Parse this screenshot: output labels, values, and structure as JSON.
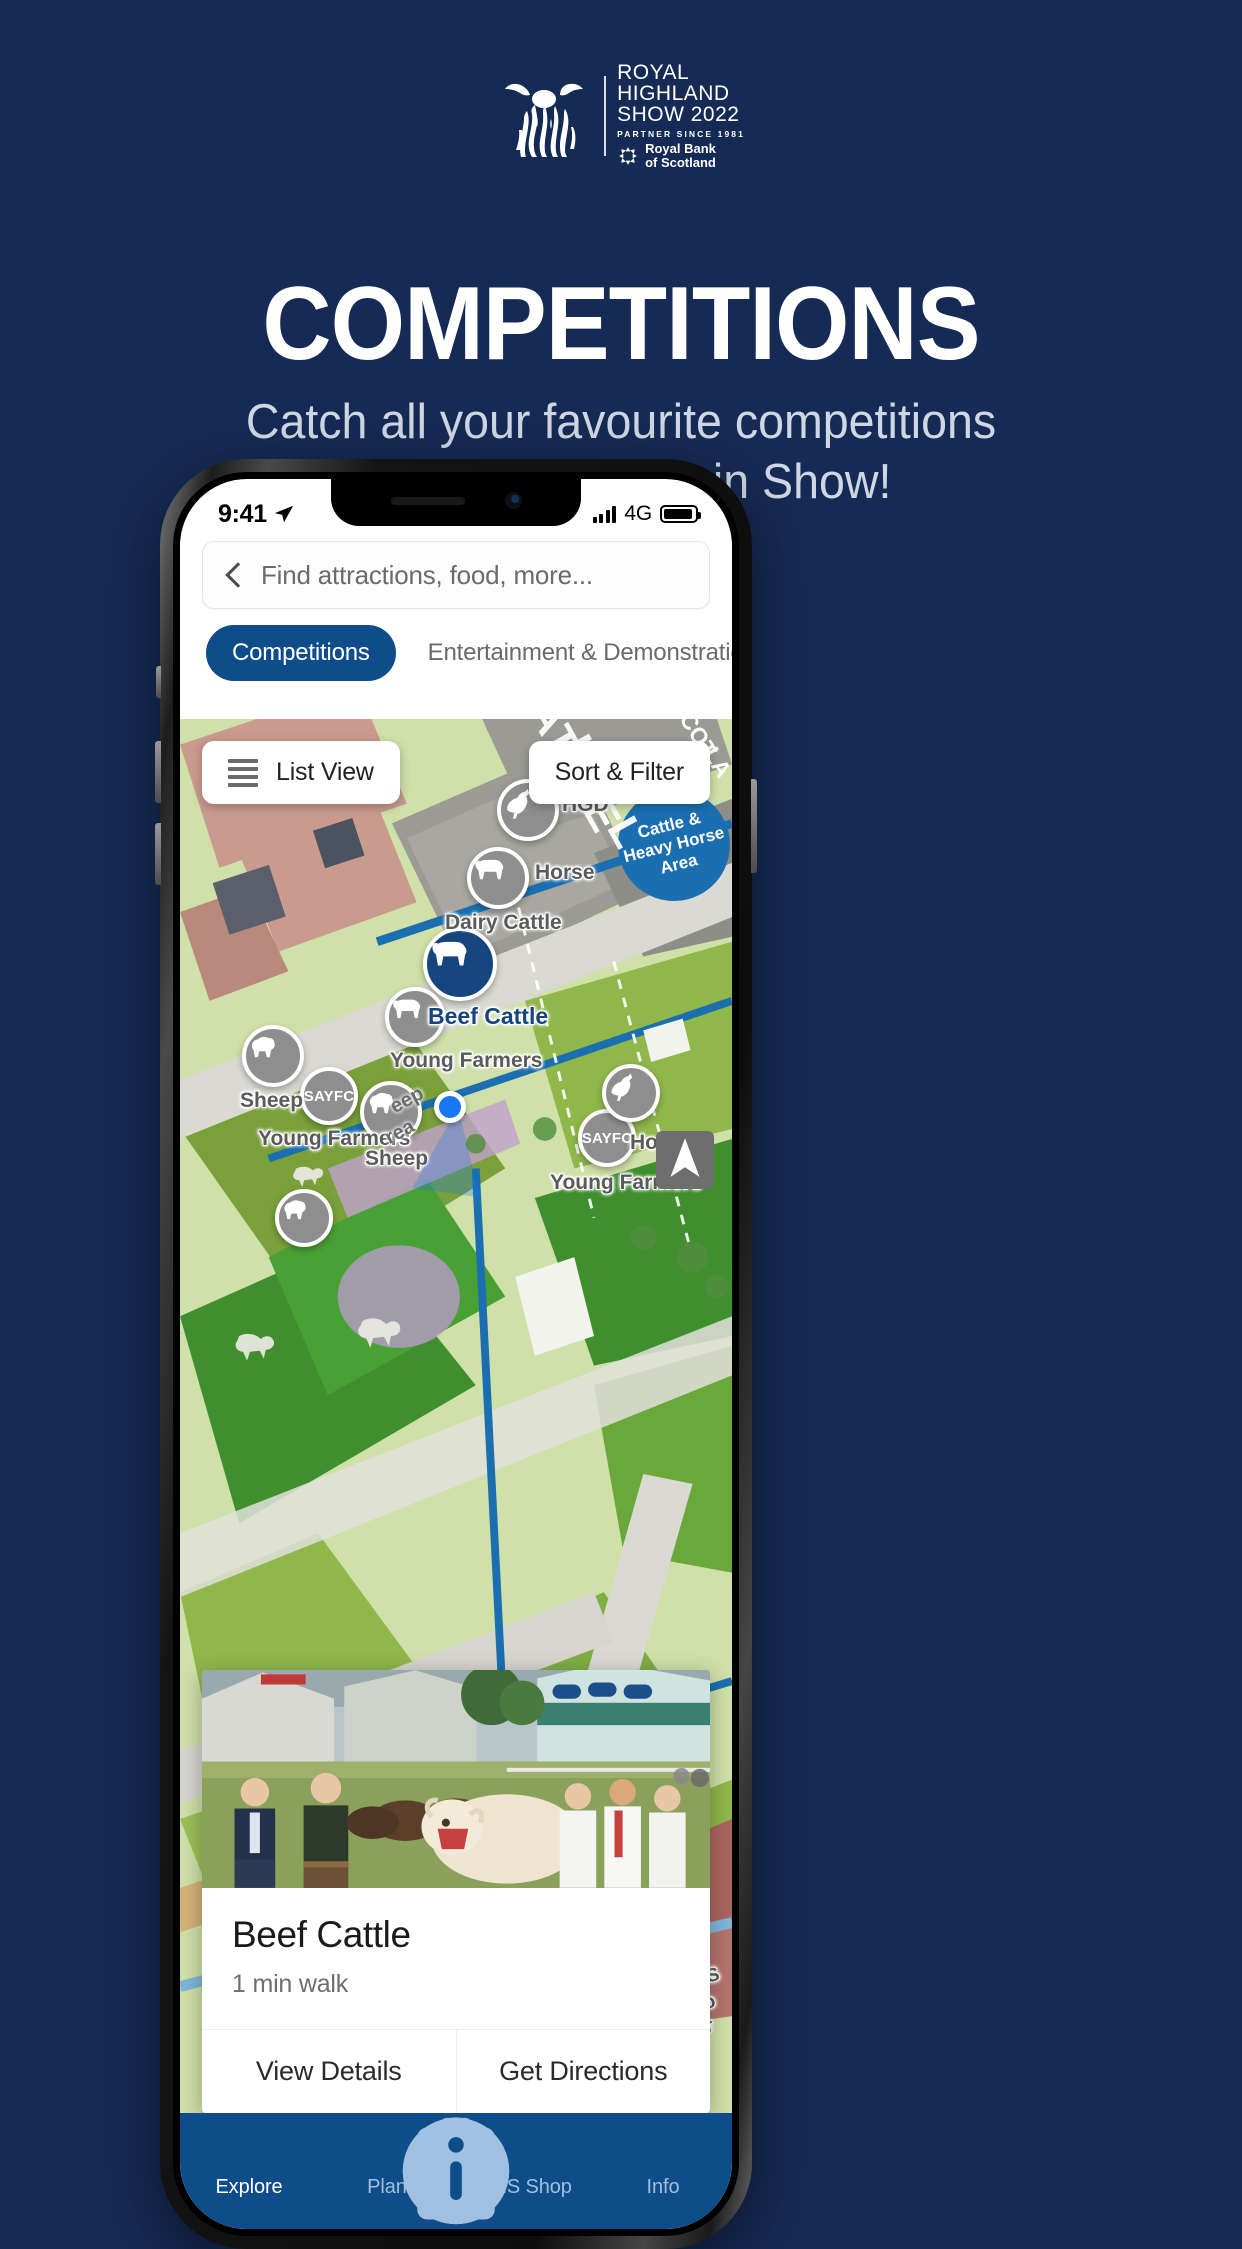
{
  "brand": {
    "logo_lines": [
      "ROYAL",
      "HIGHLAND",
      "SHOW 2022"
    ],
    "partner_line": "PARTNER SINCE 1981",
    "bank_name_line1": "Royal Bank",
    "bank_name_line2": "of Scotland",
    "cow_icon": "highland-cow-icon",
    "bank_icon": "rbs-daisy-icon"
  },
  "hero": {
    "headline": "COMPETITIONS",
    "subhead_line1": "Catch all your favourite competitions",
    "subhead_line2": "and see the Best in Show!"
  },
  "phone": {
    "status": {
      "time": "9:41",
      "location_icon": "location-arrow-icon",
      "signal_icon": "signal-bars-icon",
      "network": "4G",
      "battery_icon": "battery-full-icon"
    },
    "search": {
      "back_icon": "chevron-left-icon",
      "placeholder": "Find attractions, food, more..."
    },
    "tabs": [
      {
        "label": "Competitions",
        "active": true
      },
      {
        "label": "Entertainment & Demonstrations",
        "active": false
      }
    ],
    "map_buttons": {
      "list_view": "List View",
      "list_icon": "list-lines-icon",
      "sort_filter": "Sort & Filter"
    },
    "map_labels": [
      {
        "text": "CATTLE",
        "kind": "white-big"
      },
      {
        "text": "HALL",
        "kind": "white-big"
      },
      {
        "text": "SCOT",
        "kind": "white-small"
      },
      {
        "text": "LA",
        "kind": "white-small"
      },
      {
        "text": "HGD",
        "kind": "grey"
      },
      {
        "text": "Cattle &",
        "kind": "blue-area"
      },
      {
        "text": "Heavy Horse",
        "kind": "blue-area"
      },
      {
        "text": "Area",
        "kind": "blue-area"
      },
      {
        "text": "Horse",
        "kind": "grey"
      },
      {
        "text": "Dairy Cattle",
        "kind": "grey"
      },
      {
        "text": "Beef Cattle",
        "kind": "selected"
      },
      {
        "text": "Young Farmers",
        "kind": "grey"
      },
      {
        "text": "Sheep",
        "kind": "grey"
      },
      {
        "text": "Sheep",
        "kind": "grey"
      },
      {
        "text": "Sheep",
        "kind": "grey"
      },
      {
        "text": "Young Farmers",
        "kind": "grey"
      },
      {
        "text": "Young Farmers",
        "kind": "grey"
      },
      {
        "text": "Horse",
        "kind": "grey"
      },
      {
        "text": "eep",
        "kind": "area-purple"
      },
      {
        "text": "rea",
        "kind": "area-purple"
      },
      {
        "text": "RHS",
        "kind": "grey"
      },
      {
        "text": "Sco",
        "kind": "grey"
      },
      {
        "text": "Cer",
        "kind": "grey"
      }
    ],
    "map_pins": [
      {
        "icon": "horse-icon",
        "label": "HGD",
        "selected": false
      },
      {
        "icon": "cow-icon",
        "label": "Dairy Cattle",
        "selected": false
      },
      {
        "icon": "cow-icon",
        "label": "Beef Cattle",
        "selected": true
      },
      {
        "icon": "cow-icon",
        "label": "Beef Cattle secondary",
        "selected": false
      },
      {
        "icon": "cow-icon",
        "label": "Sheep area",
        "selected": false
      },
      {
        "icon": "sayfc-badge",
        "label": "SAYFC",
        "selected": false
      },
      {
        "icon": "sheep-icon",
        "label": "Sheep",
        "selected": false
      },
      {
        "icon": "sayfc-badge",
        "label": "SAYFC",
        "selected": false
      },
      {
        "icon": "horse-icon",
        "label": "Horse",
        "selected": false
      }
    ],
    "card": {
      "photo_alt": "cattle-parade-photo",
      "title": "Beef Cattle",
      "subtitle": "1 min walk",
      "primary_action": "View Details",
      "secondary_action": "Get Directions"
    },
    "bottom_nav": [
      {
        "label": "Explore",
        "icon": "compass-icon",
        "active": true
      },
      {
        "label": "Plan",
        "icon": "clipboard-list-icon",
        "active": false
      },
      {
        "label": "RHS Shop",
        "icon": "shopping-bag-icon",
        "active": false
      },
      {
        "label": "Info",
        "icon": "info-circle-icon",
        "active": false
      }
    ]
  },
  "colors": {
    "page_bg": "#152a54",
    "brand_blue": "#0f4c8a",
    "pin_selected": "#16457e",
    "pin_grey": "#8e8e8e",
    "user_dot": "#1877f2",
    "subhead": "#cfd7e4"
  }
}
